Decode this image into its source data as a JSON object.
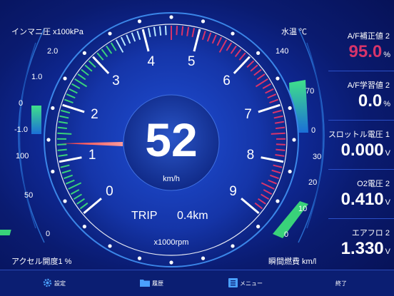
{
  "gauge": {
    "speed": "52",
    "speed_unit": "km/h",
    "trip_label": "TRIP",
    "trip_value": "0.4km",
    "rpm_unit": "x1000rpm",
    "rpm_ticks": [
      "0",
      "1",
      "2",
      "3",
      "4",
      "5",
      "6",
      "7",
      "8",
      "9"
    ]
  },
  "left_top": {
    "title": "インマニ圧 x100kPa",
    "ticks": [
      "2.0",
      "1.0",
      "0",
      "-1.0"
    ]
  },
  "left_bottom": {
    "title": "アクセル開度1 %",
    "ticks": [
      "100",
      "50",
      "0"
    ]
  },
  "mid_top": {
    "title": "水温 ℃",
    "ticks": [
      "140",
      "70",
      "0"
    ]
  },
  "mid_bottom": {
    "title": "瞬間燃費 km/l",
    "ticks": [
      "30",
      "20",
      "10",
      "0"
    ]
  },
  "panels": [
    {
      "title": "A/F補正値 2",
      "value": "95.0",
      "unit": "%",
      "color": "#d8346a"
    },
    {
      "title": "A/F学習値 2",
      "value": "0.0",
      "unit": "%",
      "color": "#ffffff"
    },
    {
      "title": "スロットル電圧 1",
      "value": "0.000",
      "unit": "V",
      "color": "#ffffff"
    },
    {
      "title": "O2電圧 2",
      "value": "0.410",
      "unit": "V",
      "color": "#ffffff"
    },
    {
      "title": "エアフロ 2",
      "value": "1.330",
      "unit": "V",
      "color": "#ffffff"
    }
  ],
  "bottom_bar": {
    "settings": "設定",
    "history": "履歴",
    "menu": "メニュー",
    "exit": "終了"
  },
  "colors": {
    "accent_green": "#39d27a",
    "accent_pink": "#d8346a",
    "needle": "#e02a2a"
  }
}
